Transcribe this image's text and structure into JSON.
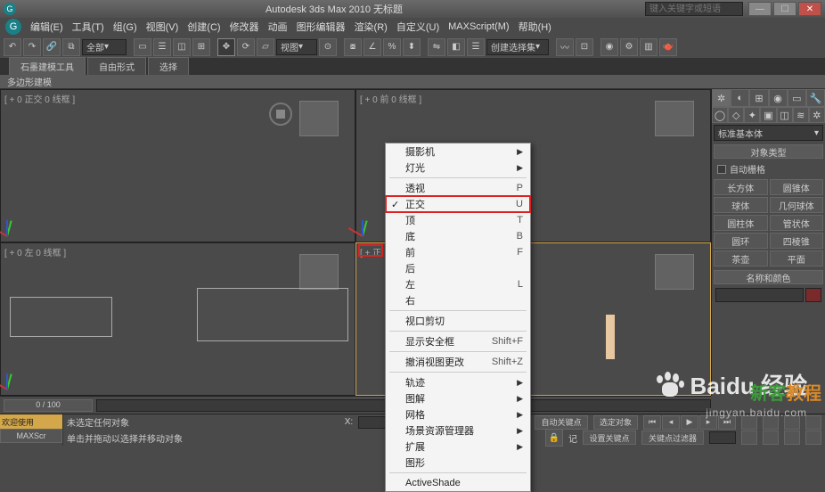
{
  "app": {
    "title": "Autodesk 3ds Max 2010    无标题",
    "search_placeholder": "键入关键字或短语"
  },
  "menu": [
    "编辑(E)",
    "工具(T)",
    "组(G)",
    "视图(V)",
    "创建(C)",
    "修改器",
    "动画",
    "图形编辑器",
    "渲染(R)",
    "自定义(U)",
    "MAXScript(M)",
    "帮助(H)"
  ],
  "toolbar": {
    "scope": "全部",
    "viewmode": "视图",
    "createset": "创建选择集"
  },
  "ribbon": {
    "tabs": [
      "石墨建模工具",
      "自由形式",
      "选择"
    ],
    "panel": "多边形建模"
  },
  "viewports": {
    "tl": "[ + 0 正交 0 线框 ]",
    "tr": "[ + 0 前 0 线框 ]",
    "bl": "[ + 0 左 0 线框 ]",
    "br": "[ + 正"
  },
  "ctx": {
    "items": [
      {
        "label": "摄影机",
        "sub": true
      },
      {
        "label": "灯光",
        "sub": true
      },
      {
        "sep": true
      },
      {
        "label": "透视",
        "short": "P"
      },
      {
        "label": "正交",
        "short": "U",
        "check": true,
        "hl": true
      },
      {
        "label": "顶",
        "short": "T"
      },
      {
        "label": "底",
        "short": "B"
      },
      {
        "label": "前",
        "short": "F"
      },
      {
        "label": "后"
      },
      {
        "label": "左",
        "short": "L"
      },
      {
        "label": "右"
      },
      {
        "sep": true
      },
      {
        "label": "视口剪切"
      },
      {
        "sep": true
      },
      {
        "label": "显示安全框",
        "short": "Shift+F"
      },
      {
        "sep": true
      },
      {
        "label": "撤消视图更改",
        "short": "Shift+Z"
      },
      {
        "sep": true
      },
      {
        "label": "轨迹",
        "sub": true
      },
      {
        "label": "图解",
        "sub": true
      },
      {
        "label": "网格",
        "sub": true
      },
      {
        "label": "场景资源管理器",
        "sub": true
      },
      {
        "label": "扩展",
        "sub": true
      },
      {
        "label": "图形"
      },
      {
        "sep": true
      },
      {
        "label": "ActiveShade"
      }
    ]
  },
  "cmd": {
    "category": "标准基本体",
    "rollout_objtype": "对象类型",
    "autogrid": "自动栅格",
    "prims": [
      "长方体",
      "圆锥体",
      "球体",
      "几何球体",
      "圆柱体",
      "管状体",
      "圆环",
      "四棱锥",
      "茶壶",
      "平面"
    ],
    "rollout_name": "名称和颜色"
  },
  "timeline": {
    "slider": "0 / 100"
  },
  "status": {
    "welcome": "欢迎使用",
    "script": "MAXScr",
    "line1": "未选定任何对象",
    "line2": "单击并拖动以选择并移动对象",
    "autokey": "自动关键点",
    "selected": "选定对象",
    "setkey": "设置关键点",
    "keyfilter": "关键点过滤器"
  },
  "watermark": {
    "brand": "Baidu 经验",
    "url": "jingyan.baidu.com",
    "corner1": "新客",
    "corner2": "教程"
  }
}
